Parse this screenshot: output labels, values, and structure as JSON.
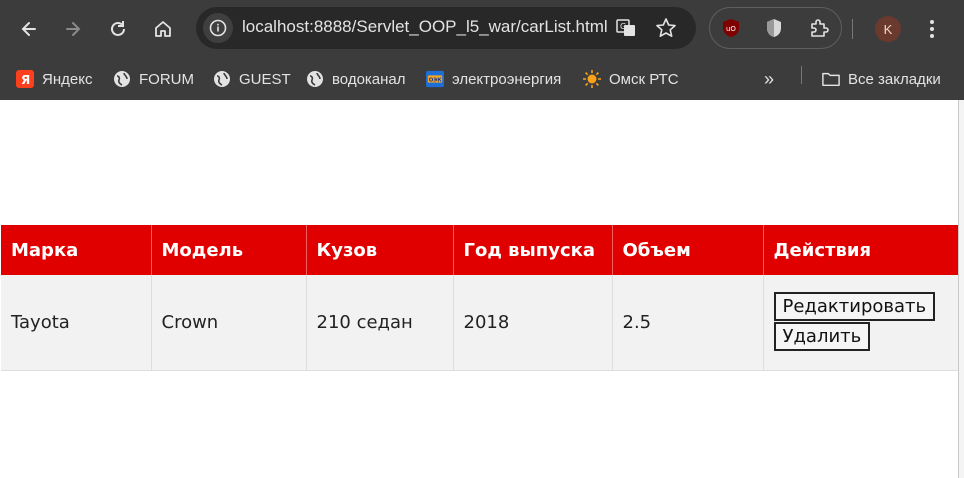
{
  "browser": {
    "url": "localhost:8888/Servlet_OOP_l5_war/carList.html",
    "profile_initial": "K",
    "accent": "#3c3c3c"
  },
  "bookmarks": {
    "items": [
      {
        "label": "Яндекс",
        "icon": "yandex-icon"
      },
      {
        "label": "FORUM",
        "icon": "globe-icon"
      },
      {
        "label": "GUEST",
        "icon": "globe-icon"
      },
      {
        "label": "водоканал",
        "icon": "globe-icon"
      },
      {
        "label": "электроэнергия",
        "icon": "energy-icon"
      },
      {
        "label": "Омск РТС",
        "icon": "sun-icon"
      }
    ],
    "overflow": "»",
    "all_bookmarks": "Все закладки"
  },
  "table": {
    "header_color": "#e00000",
    "headers": [
      "Марка",
      "Модель",
      "Кузов",
      "Год выпуска",
      "Объем",
      "Действия"
    ],
    "rows": [
      {
        "brand": "Tayota",
        "model": "Crown",
        "body": "210 седан",
        "year": "2018",
        "volume": "2.5"
      }
    ],
    "edit_label": "Редактировать",
    "delete_label": "Удалить"
  }
}
